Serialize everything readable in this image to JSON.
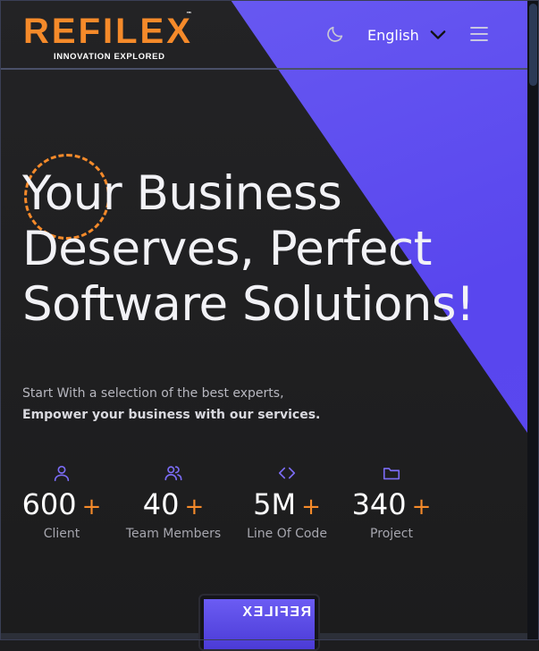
{
  "header": {
    "logo_main": "REFILEX",
    "logo_tm": "™",
    "logo_tagline": "INNOVATION EXPLORED",
    "language": "English",
    "icons": {
      "theme": "moon-icon",
      "language_toggle": "chevron-down-icon",
      "menu": "hamburger-menu-icon"
    }
  },
  "hero": {
    "title_line1": "Your Business",
    "title_line2": "Deserves, Perfect",
    "title_line3": "Software Solutions!",
    "subtitle_line1": "Start With a selection of the best experts,",
    "subtitle_line2": "Empower your business with our services."
  },
  "stats": [
    {
      "value": "600",
      "suffix": "+",
      "label": "Client",
      "icon": "user-icon"
    },
    {
      "value": "40",
      "suffix": "+",
      "label": "Team Members",
      "icon": "users-icon"
    },
    {
      "value": "5M",
      "suffix": "+",
      "label": "Line Of Code",
      "icon": "code-icon"
    },
    {
      "value": "340",
      "suffix": "+",
      "label": "Project",
      "icon": "folder-icon"
    }
  ],
  "colors": {
    "accent_orange": "#f58a2a",
    "accent_purple": "#5946ee",
    "background": "#1d1d1f",
    "stat_icon": "#7b6cf5"
  }
}
